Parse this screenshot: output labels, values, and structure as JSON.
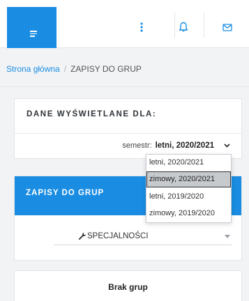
{
  "breadcrumb": {
    "home": "Strona główna",
    "separator": "/",
    "current": "ZAPISY DO GRUP"
  },
  "display_card": {
    "title": "DANE WYŚWIETLANE DLA:",
    "semester_label": "semestr:",
    "semester_value": "letni, 2020/2021"
  },
  "semester_dropdown": {
    "options": [
      "letni, 2020/2021",
      "zimowy, 2020/2021",
      "letni, 2019/2020",
      "zimowy, 2019/2020"
    ],
    "highlighted": "zimowy, 2020/2021"
  },
  "groups_card": {
    "title": "ZAPISY DO GRUP",
    "select_value": "SPECJALNOŚCI"
  },
  "empty_card": {
    "text": "Brak grup"
  },
  "colors": {
    "accent": "#1a8de3",
    "background": "#f2f3f5"
  },
  "icons": [
    "menu-icon",
    "more-vertical-icon",
    "bell-icon",
    "mail-icon",
    "chevron-down-icon",
    "wrench-icon"
  ]
}
